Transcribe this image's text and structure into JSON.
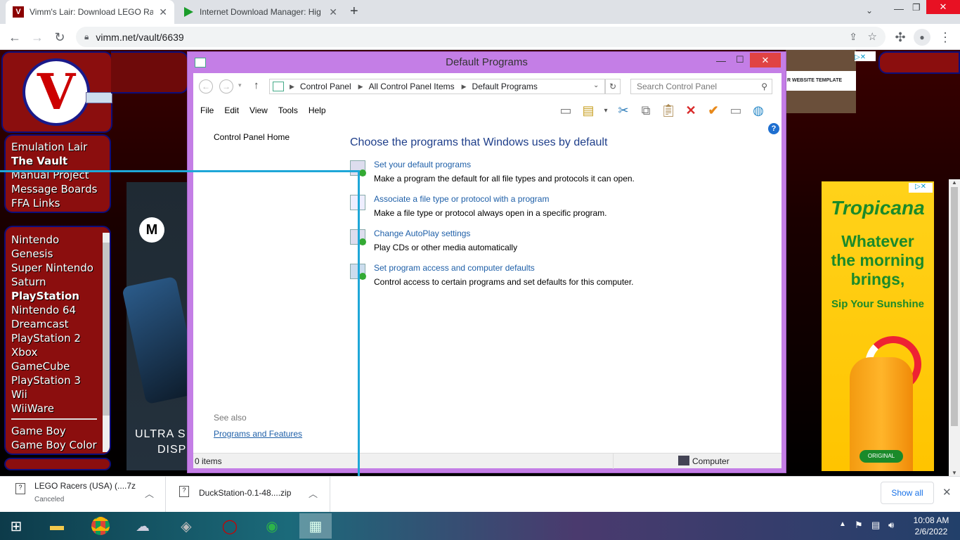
{
  "browser": {
    "tabs": [
      {
        "title": "Vimm's Lair: Download LEGO Rac",
        "active": true
      },
      {
        "title": "Internet Download Manager: Hig",
        "active": false
      }
    ],
    "new_tab": "+",
    "url": "vimm.net/vault/6639",
    "icons": [
      "back-icon",
      "forward-icon",
      "reload-icon",
      "lock-icon",
      "share-icon",
      "star-icon",
      "extensions-icon",
      "profile-icon",
      "menu-icon"
    ]
  },
  "site": {
    "nav_main": [
      "Emulation Lair",
      "The Vault",
      "Manual Project",
      "Message Boards",
      "FFA Links"
    ],
    "nav_systems": [
      "Nintendo",
      "Genesis",
      "Super Nintendo",
      "Saturn",
      "PlayStation",
      "Nintendo 64",
      "Dreamcast",
      "PlayStation 2",
      "Xbox",
      "GameCube",
      "PlayStation 3",
      "Wii",
      "WiiWare"
    ],
    "nav_handheld": [
      "Game Boy",
      "Game Boy Color"
    ],
    "ad_left_text1": "ULTRA S",
    "ad_left_text2": "DISP",
    "ad_top_text": "R WEBSITE TEMPLATE",
    "ad_right": {
      "brand": "Tropicana",
      "line1": "Whatever",
      "line2": "the morning",
      "line3": "brings,",
      "tagline": "Sip Your Sunshine",
      "label": "ORIGINAL"
    }
  },
  "dialog": {
    "title": "Default Programs",
    "breadcrumb": [
      "Control Panel",
      "All Control Panel Items",
      "Default Programs"
    ],
    "search_placeholder": "Search Control Panel",
    "menu": [
      "File",
      "Edit",
      "View",
      "Tools",
      "Help"
    ],
    "sidebar_home": "Control Panel Home",
    "see_also": "See also",
    "see_also_link": "Programs and Features",
    "heading": "Choose the programs that Windows uses by default",
    "items": [
      {
        "link": "Set your default programs",
        "desc": "Make a program the default for all file types and protocols it can open."
      },
      {
        "link": "Associate a file type or protocol with a program",
        "desc": "Make a file type or protocol always open in a specific program."
      },
      {
        "link": "Change AutoPlay settings",
        "desc": "Play CDs or other media automatically"
      },
      {
        "link": "Set program access and computer defaults",
        "desc": "Control access to certain programs and set defaults for this computer."
      }
    ],
    "status_items": "0 items",
    "status_location": "Computer"
  },
  "downloads": [
    {
      "name": "LEGO Racers (USA) (....7z",
      "status": "Canceled"
    },
    {
      "name": "DuckStation-0.1-48....zip",
      "status": ""
    }
  ],
  "show_all": "Show all",
  "taskbar": {
    "time": "10:08 AM",
    "date": "2/6/2022"
  },
  "colors": {
    "dialog_frame": "#c47ee6",
    "site_red": "#8b0e0e",
    "link_blue": "#1e5fa8",
    "highlight_cyan": "#1ea7d8"
  }
}
